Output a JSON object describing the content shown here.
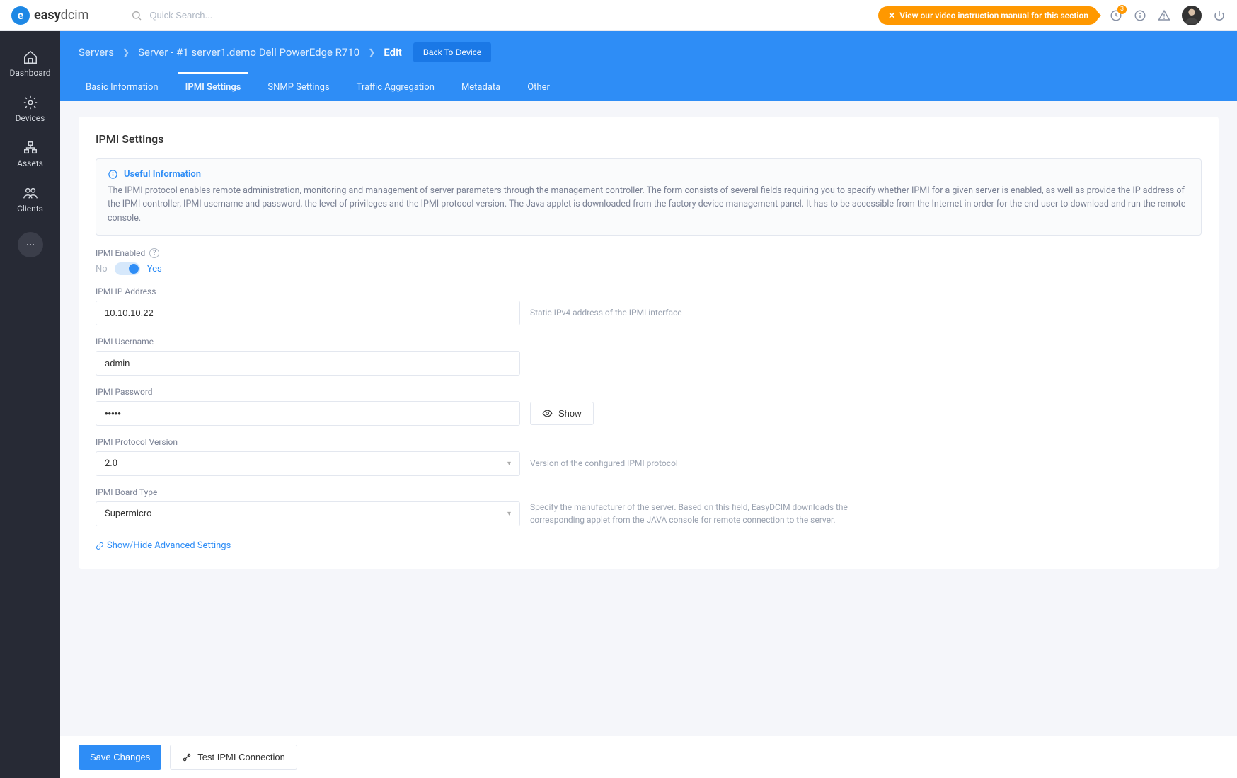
{
  "brand": {
    "name_bold": "easy",
    "name_light": "dcim"
  },
  "search": {
    "placeholder": "Quick Search..."
  },
  "video_banner": "View our video instruction manual for this section",
  "notif_badge": "3",
  "sidebar": {
    "items": [
      {
        "label": "Dashboard"
      },
      {
        "label": "Devices"
      },
      {
        "label": "Assets"
      },
      {
        "label": "Clients"
      }
    ]
  },
  "breadcrumb": {
    "c1": "Servers",
    "c2": "Server - #1 server1.demo Dell PowerEdge R710",
    "c3": "Edit",
    "back": "Back To Device"
  },
  "tabs": {
    "t0": "Basic Information",
    "t1": "IPMI Settings",
    "t2": "SNMP Settings",
    "t3": "Traffic Aggregation",
    "t4": "Metadata",
    "t5": "Other"
  },
  "page": {
    "title": "IPMI Settings",
    "info_title": "Useful Information",
    "info_body": "The IPMI protocol enables remote administration, monitoring and management of server parameters through the management controller. The form consists of several fields requiring you to specify whether IPMI for a given server is enabled, as well as provide the IP address of the IPMI controller, IPMI username and password, the level of privileges and the IPMI protocol version. The Java applet is downloaded from the factory device management panel. It has to be accessible from the Internet in order for the end user to download and run the remote console.",
    "enabled_label": "IPMI Enabled",
    "toggle_no": "No",
    "toggle_yes": "Yes",
    "ip_label": "IPMI IP Address",
    "ip_value": "10.10.10.22",
    "ip_hint": "Static IPv4 address of the IPMI interface",
    "user_label": "IPMI Username",
    "user_value": "admin",
    "pass_label": "IPMI Password",
    "pass_value": "•••••",
    "show_btn": "Show",
    "proto_label": "IPMI Protocol Version",
    "proto_value": "2.0",
    "proto_hint": "Version of the configured IPMI protocol",
    "board_label": "IPMI Board Type",
    "board_value": "Supermicro",
    "board_hint": "Specify the manufacturer of the server. Based on this field, EasyDCIM downloads the corresponding applet from the JAVA console for remote connection to the server.",
    "adv_link": "Show/Hide Advanced Settings"
  },
  "footer": {
    "save": "Save Changes",
    "test": "Test IPMI Connection"
  }
}
